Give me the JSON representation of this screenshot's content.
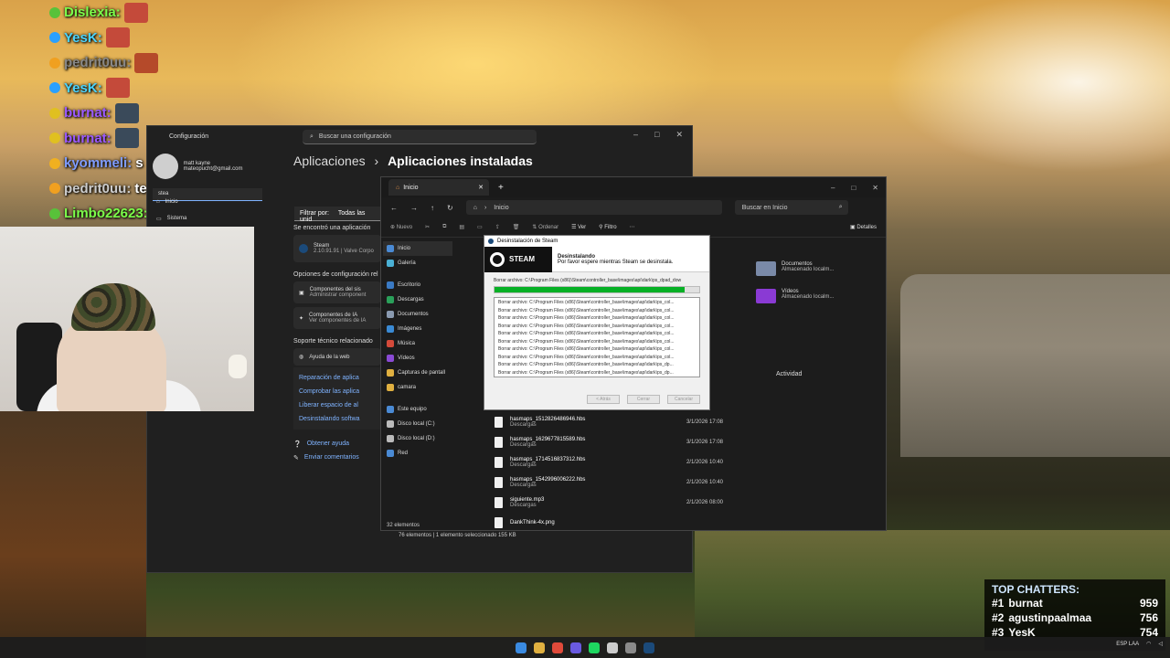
{
  "chat": [
    {
      "user": "Dislexia:",
      "color": "#7cff4a",
      "message": "",
      "badge_color": "#58c23a",
      "emote_color": "#c44a3a"
    },
    {
      "user": "YesK:",
      "color": "#4ad4ff",
      "message": "",
      "badge_color": "#2aa0ff",
      "emote_color": "#c44a3a"
    },
    {
      "user": "pedrit0uu:",
      "color": "#888888",
      "message": "",
      "badge_color": "#f0a020",
      "emote_color": "#b54a2a"
    },
    {
      "user": "YesK:",
      "color": "#4ad4ff",
      "message": "",
      "badge_color": "#2aa0ff",
      "emote_color": "#c44a3a"
    },
    {
      "user": "burnat:",
      "color": "#9b59ff",
      "message": "",
      "badge_color": "#e0c020",
      "emote_color": "#3a4a5a"
    },
    {
      "user": "burnat:",
      "color": "#9b59ff",
      "message": "",
      "badge_color": "#e0c020",
      "emote_color": "#3a4a5a"
    },
    {
      "user": "kyommeli:",
      "color": "#7f9cff",
      "message": "s",
      "badge_color": "#f0b020",
      "emote_color": "#777777"
    },
    {
      "user": "pedrit0uu:",
      "color": "#cccccc",
      "message": "te borra la cuenta",
      "badge_color": "#f0a020",
      "emote_color": "#b54a2a"
    },
    {
      "user": "Limbo22623:",
      "color": "#7cff4a",
      "message": "",
      "badge_color": "#58c23a",
      "emote_color": "#b54a2a"
    }
  ],
  "settings": {
    "title": "Configuración",
    "search_placeholder": "Buscar una configuración",
    "user_name": "matt kayne",
    "user_email": "mateopucht@gmail.com",
    "search_value": "stea",
    "nav": [
      "Inicio",
      "Sistema"
    ],
    "breadcrumb_parent": "Aplicaciones",
    "breadcrumb_sep": "›",
    "breadcrumb_current": "Aplicaciones instaladas",
    "filter_label": "Filtrar por:",
    "filter_value": "Todas las unid",
    "found_text": "Se encontró una aplicación",
    "app_name": "Steam",
    "app_meta": "2.10.91.91  |  Valve Corpo",
    "options_heading": "Opciones de configuración rel",
    "opt1_title": "Componentes del sis",
    "opt1_sub": "Administrar component",
    "opt2_title": "Componentes de IA",
    "opt2_sub": "Ver componentes de IA",
    "support_heading": "Soporte técnico relacionado",
    "help_web": "Ayuda de la web",
    "links": [
      "Reparación de aplica",
      "Comprobar las aplica",
      "Liberar espacio de al",
      "Desinstalando softwa"
    ],
    "get_help": "Obtener ayuda",
    "feedback": "Enviar comentarios"
  },
  "explorer": {
    "tab": "Inicio",
    "address": "Inicio",
    "search_placeholder": "Buscar en Inicio",
    "cmd_new": "Nuevo",
    "cmd_sort": "Ordenar",
    "cmd_view": "Ver",
    "cmd_filter": "Filtro",
    "details": "Detalles",
    "sidebar": [
      {
        "label": "Inicio",
        "color": "#4a8ad4"
      },
      {
        "label": "Galería",
        "color": "#4ab0d4"
      },
      {
        "label": "Escritorio",
        "color": "#3a7ac4"
      },
      {
        "label": "Descargas",
        "color": "#2aa05a"
      },
      {
        "label": "Documentos",
        "color": "#8a9ab0"
      },
      {
        "label": "Imágenes",
        "color": "#3a8ad4"
      },
      {
        "label": "Música",
        "color": "#d44a3a"
      },
      {
        "label": "Vídeos",
        "color": "#8a4ad4"
      },
      {
        "label": "Capturas de pantall",
        "color": "#e0b040"
      },
      {
        "label": "camara",
        "color": "#e0b040"
      },
      {
        "label": "Este equipo",
        "color": "#4a8ad4"
      },
      {
        "label": "Disco local (C:)",
        "color": "#bbbbbb"
      },
      {
        "label": "Disco local (D:)",
        "color": "#bbbbbb"
      },
      {
        "label": "Red",
        "color": "#4a8ad4"
      }
    ],
    "quick_access": [
      {
        "name": "Documentos",
        "sub": "Almacenado localm...",
        "color": "#7a8aa8"
      },
      {
        "name": "Vídeos",
        "sub": "Almacenado localm...",
        "color": "#8a3ad4"
      }
    ],
    "activity_label": "Actividad",
    "files": [
      {
        "name": "hasmaps_1512826486946.hbs",
        "loc": "Descargas",
        "date": "3/1/2026 17:08"
      },
      {
        "name": "hasmaps_1629677815589.hbs",
        "loc": "Descargas",
        "date": "3/1/2026 17:08"
      },
      {
        "name": "hasmaps_1714516837312.hbs",
        "loc": "Descargas",
        "date": "2/1/2026 10:40"
      },
      {
        "name": "hasmaps_1542996006222.hbs",
        "loc": "Descargas",
        "date": "2/1/2026 10:40"
      },
      {
        "name": "siguiente.mp3",
        "loc": "Descargas",
        "date": "2/1/2026 08:00"
      },
      {
        "name": "DankThink-4x.png",
        "loc": "",
        "date": ""
      }
    ],
    "status_inner": "32 elementos",
    "status_outer": "76 elementos  |  1 elemento seleccionado  155 KB"
  },
  "dialog": {
    "title": "Desinstalación de Steam",
    "logo_text": "STEAM",
    "heading": "Desinstalando",
    "subheading": "Por favor espere mientras Steam se desinstala.",
    "progress_label": "Borrar archivo: C:\\Program Files (x86)\\Steam\\controller_base\\images\\api\\dark\\ps_dpad_dow",
    "progress_fraction": 0.93,
    "log": [
      "Borrar archivo: C:\\Program Files (x86)\\Steam\\controller_base\\images\\api\\dark\\ps_col...",
      "Borrar archivo: C:\\Program Files (x86)\\Steam\\controller_base\\images\\api\\dark\\ps_col...",
      "Borrar archivo: C:\\Program Files (x86)\\Steam\\controller_base\\images\\api\\dark\\ps_col...",
      "Borrar archivo: C:\\Program Files (x86)\\Steam\\controller_base\\images\\api\\dark\\ps_col...",
      "Borrar archivo: C:\\Program Files (x86)\\Steam\\controller_base\\images\\api\\dark\\ps_col...",
      "Borrar archivo: C:\\Program Files (x86)\\Steam\\controller_base\\images\\api\\dark\\ps_col...",
      "Borrar archivo: C:\\Program Files (x86)\\Steam\\controller_base\\images\\api\\dark\\ps_col...",
      "Borrar archivo: C:\\Program Files (x86)\\Steam\\controller_base\\images\\api\\dark\\ps_col...",
      "Borrar archivo: C:\\Program Files (x86)\\Steam\\controller_base\\images\\api\\dark\\ps_dp...",
      "Borrar archivo: C:\\Program Files (x86)\\Steam\\controller_base\\images\\api\\dark\\ps_dp..."
    ],
    "btn_back": "< Atrás",
    "btn_close": "Cerrar",
    "btn_cancel": "Cancelar"
  },
  "top_chatters": {
    "title": "TOP CHATTERS:",
    "rows": [
      {
        "rank": "#1",
        "name": "burnat",
        "count": "959"
      },
      {
        "rank": "#2",
        "name": "agustinpaalmaa",
        "count": "756"
      },
      {
        "rank": "#3",
        "name": "YesK",
        "count": "754"
      }
    ]
  },
  "taskbar": {
    "icons": [
      {
        "name": "start-icon",
        "color": "#3a8ae0"
      },
      {
        "name": "file-explorer-icon",
        "color": "#e0b040"
      },
      {
        "name": "chrome-icon",
        "color": "#e04a3a"
      },
      {
        "name": "discord-icon",
        "color": "#6a5ae0"
      },
      {
        "name": "spotify-icon",
        "color": "#1ed760"
      },
      {
        "name": "obs-icon",
        "color": "#cccccc"
      },
      {
        "name": "settings-icon",
        "color": "#8a8a8a"
      },
      {
        "name": "steam-icon",
        "color": "#1b4a7a"
      }
    ],
    "lang": "ESP LAA"
  }
}
